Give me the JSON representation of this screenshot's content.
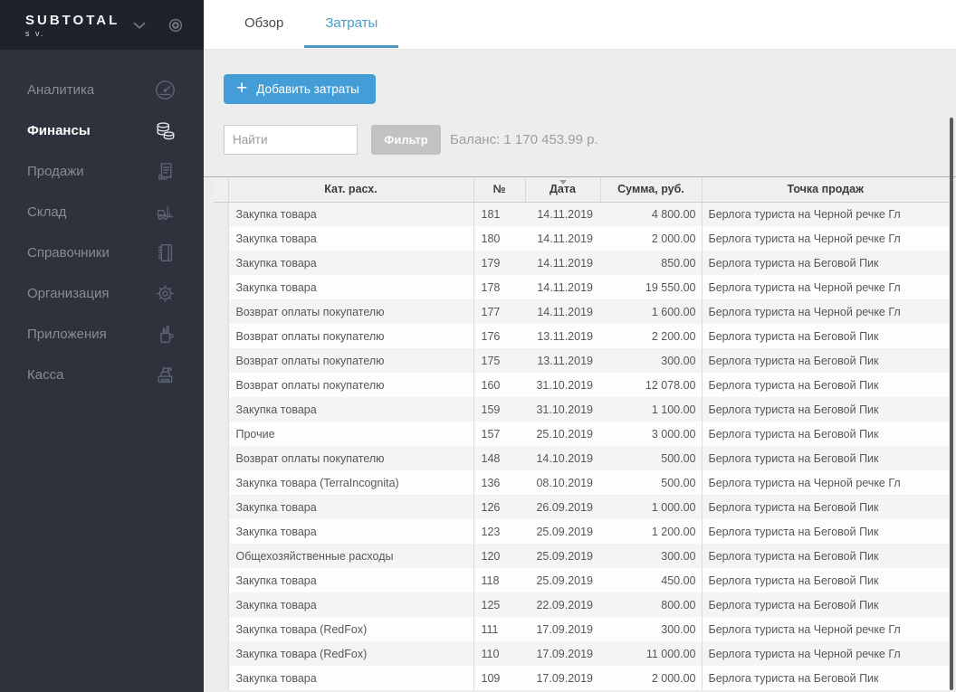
{
  "app": {
    "name": "SUBTOTAL",
    "subtitle": "s v."
  },
  "colors": {
    "accent_blue": "#459dd8",
    "tab_active_blue": "#4a97bb",
    "sidebar_bg": "#2d323d",
    "sidebar_header_bg": "#1e222b",
    "content_bg": "#ededed",
    "filter_gray": "#c2c2c2"
  },
  "sidebar": {
    "header_icons": [
      "chevron-down-icon",
      "target-icon"
    ],
    "items": [
      {
        "label": "Аналитика",
        "icon": "gauge-icon",
        "active": false
      },
      {
        "label": "Финансы",
        "icon": "coins-icon",
        "active": true
      },
      {
        "label": "Продажи",
        "icon": "receipt-icon",
        "active": false
      },
      {
        "label": "Склад",
        "icon": "forklift-icon",
        "active": false
      },
      {
        "label": "Справочники",
        "icon": "notebook-icon",
        "active": false
      },
      {
        "label": "Организация",
        "icon": "gear-icon",
        "active": false
      },
      {
        "label": "Приложения",
        "icon": "pencil-cup-icon",
        "active": false
      },
      {
        "label": "Касса",
        "icon": "cash-register-icon",
        "active": false
      }
    ]
  },
  "tabs": [
    {
      "label": "Обзор",
      "active": false
    },
    {
      "label": "Затраты",
      "active": true
    }
  ],
  "toolbar": {
    "add_button_label": "Добавить затраты",
    "add_button_plus": "+",
    "search_placeholder": "Найти",
    "search_value": "",
    "filter_button_label": "Фильтр",
    "balance_text": "Баланс: 1 170 453.99 р."
  },
  "table": {
    "columns": [
      "",
      "Кат. расх.",
      "№",
      "Дата",
      "Сумма, руб.",
      "Точка продаж"
    ],
    "sorted_column": "Дата",
    "sort_direction": "desc",
    "rows": [
      {
        "category": "Закупка товара",
        "number": "181",
        "date": "14.11.2019",
        "amount": "4 800.00",
        "outlet": "Берлога туриста на Черной речке Гл"
      },
      {
        "category": "Закупка товара",
        "number": "180",
        "date": "14.11.2019",
        "amount": "2 000.00",
        "outlet": "Берлога туриста на Черной речке Гл"
      },
      {
        "category": "Закупка товара",
        "number": "179",
        "date": "14.11.2019",
        "amount": "850.00",
        "outlet": "Берлога туриста на Беговой Пик"
      },
      {
        "category": "Закупка товара",
        "number": "178",
        "date": "14.11.2019",
        "amount": "19 550.00",
        "outlet": "Берлога туриста на Черной речке Гл"
      },
      {
        "category": "Возврат оплаты покупателю",
        "number": "177",
        "date": "14.11.2019",
        "amount": "1 600.00",
        "outlet": "Берлога туриста на Черной речке Гл"
      },
      {
        "category": "Возврат оплаты покупателю",
        "number": "176",
        "date": "13.11.2019",
        "amount": "2 200.00",
        "outlet": "Берлога туриста на Беговой Пик"
      },
      {
        "category": "Возврат оплаты покупателю",
        "number": "175",
        "date": "13.11.2019",
        "amount": "300.00",
        "outlet": "Берлога туриста на Беговой Пик"
      },
      {
        "category": "Возврат оплаты покупателю",
        "number": "160",
        "date": "31.10.2019",
        "amount": "12 078.00",
        "outlet": "Берлога туриста на Беговой Пик"
      },
      {
        "category": "Закупка товара",
        "number": "159",
        "date": "31.10.2019",
        "amount": "1 100.00",
        "outlet": "Берлога туриста на Беговой Пик"
      },
      {
        "category": "Прочие",
        "number": "157",
        "date": "25.10.2019",
        "amount": "3 000.00",
        "outlet": "Берлога туриста на Беговой Пик"
      },
      {
        "category": "Возврат оплаты покупателю",
        "number": "148",
        "date": "14.10.2019",
        "amount": "500.00",
        "outlet": "Берлога туриста на Беговой Пик"
      },
      {
        "category": "Закупка товара (TerraIncognita)",
        "number": "136",
        "date": "08.10.2019",
        "amount": "500.00",
        "outlet": "Берлога туриста на Черной речке Гл"
      },
      {
        "category": "Закупка товара",
        "number": "126",
        "date": "26.09.2019",
        "amount": "1 000.00",
        "outlet": "Берлога туриста на Беговой Пик"
      },
      {
        "category": "Закупка товара",
        "number": "123",
        "date": "25.09.2019",
        "amount": "1 200.00",
        "outlet": "Берлога туриста на Беговой Пик"
      },
      {
        "category": "Общехозяйственные расходы",
        "number": "120",
        "date": "25.09.2019",
        "amount": "300.00",
        "outlet": "Берлога туриста на Беговой Пик"
      },
      {
        "category": "Закупка товара",
        "number": "118",
        "date": "25.09.2019",
        "amount": "450.00",
        "outlet": "Берлога туриста на Беговой Пик"
      },
      {
        "category": "Закупка товара",
        "number": "125",
        "date": "22.09.2019",
        "amount": "800.00",
        "outlet": "Берлога туриста на Беговой Пик"
      },
      {
        "category": "Закупка товара (RedFox)",
        "number": "111",
        "date": "17.09.2019",
        "amount": "300.00",
        "outlet": "Берлога туриста на Черной речке Гл"
      },
      {
        "category": "Закупка товара (RedFox)",
        "number": "110",
        "date": "17.09.2019",
        "amount": "11 000.00",
        "outlet": "Берлога туриста на Черной речке Гл"
      },
      {
        "category": "Закупка товара",
        "number": "109",
        "date": "17.09.2019",
        "amount": "2 000.00",
        "outlet": "Берлога туриста на Беговой Пик"
      }
    ]
  }
}
